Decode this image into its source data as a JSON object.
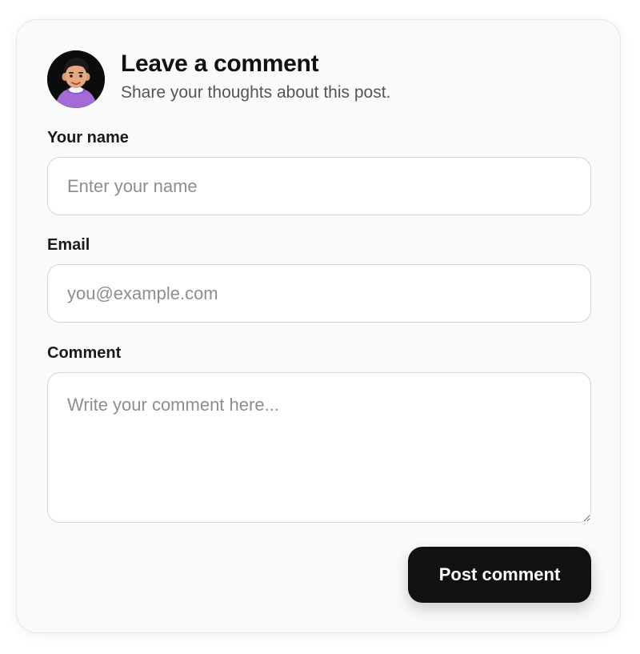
{
  "header": {
    "title": "Leave a comment",
    "subtitle": "Share your thoughts about this post."
  },
  "form": {
    "name": {
      "label": "Your name",
      "placeholder": "Enter your name",
      "value": ""
    },
    "email": {
      "label": "Email",
      "placeholder": "you@example.com",
      "value": ""
    },
    "comment": {
      "label": "Comment",
      "placeholder": "Write your comment here...",
      "value": ""
    },
    "submit_label": "Post comment"
  },
  "colors": {
    "button_bg": "#111111",
    "avatar_hoodie": "#a46ad6"
  }
}
